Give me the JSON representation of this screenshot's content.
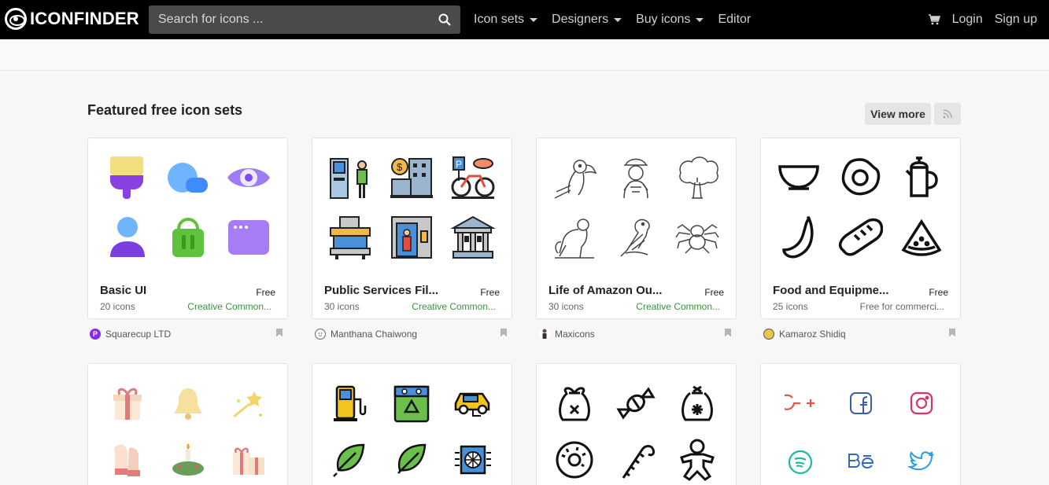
{
  "header": {
    "logo_text": "ICONFINDER",
    "search_placeholder": "Search for icons ...",
    "nav": [
      {
        "label": "Icon sets",
        "dropdown": true
      },
      {
        "label": "Designers",
        "dropdown": true
      },
      {
        "label": "Buy icons",
        "dropdown": true
      },
      {
        "label": "Editor",
        "dropdown": false
      }
    ],
    "login": "Login",
    "signup": "Sign up"
  },
  "section": {
    "title": "Featured free icon sets",
    "view_more": "View more"
  },
  "cards": [
    {
      "title": "Basic UI",
      "price": "Free",
      "count": "20 icons",
      "license": "Creative Common...",
      "author": "Squarecup LTD"
    },
    {
      "title": "Public Services Fil...",
      "price": "Free",
      "count": "30 icons",
      "license": "Creative Common...",
      "author": "Manthana Chaiwong"
    },
    {
      "title": "Life of Amazon Ou...",
      "price": "Free",
      "count": "30 icons",
      "license": "Creative Common...",
      "author": "Maxicons"
    },
    {
      "title": "Food and Equipme...",
      "price": "Free",
      "count": "25 icons",
      "license": "Free for commerci...",
      "author": "Kamaroz Shidiq"
    }
  ],
  "colors": {
    "topbar": "#000000",
    "license_green": "#3c9140",
    "background": "#f7f7f7"
  }
}
